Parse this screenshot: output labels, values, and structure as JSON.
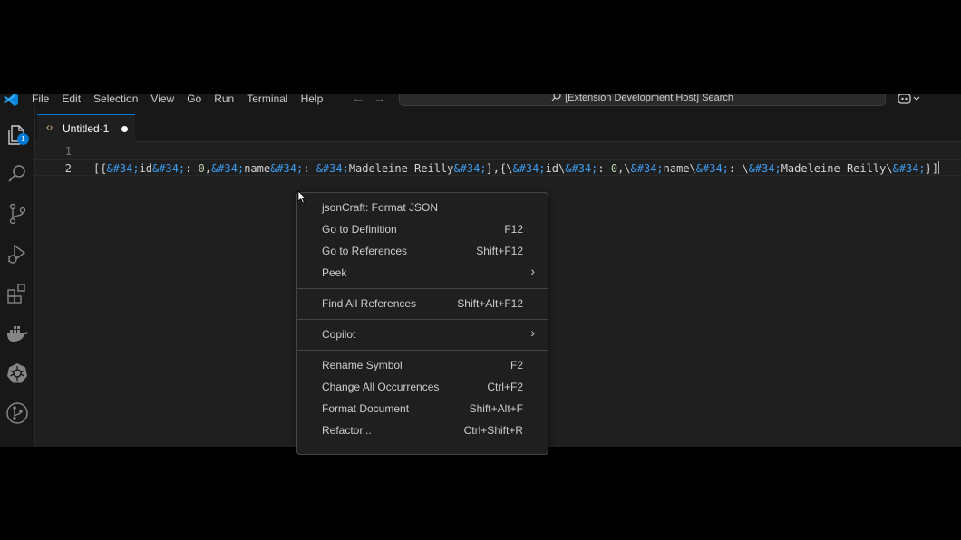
{
  "menubar": {
    "items": [
      "File",
      "Edit",
      "Selection",
      "View",
      "Go",
      "Run",
      "Terminal",
      "Help"
    ],
    "search_text": "[Extension Development Host] Search"
  },
  "icons": {
    "logo": "vscode-logo-icon",
    "back": "arrow-left-icon",
    "forward": "arrow-right-icon",
    "search": "search-icon",
    "copilot": "copilot-icon",
    "activity": [
      "explorer-icon",
      "search-icon",
      "source-control-icon",
      "run-debug-icon",
      "extensions-icon",
      "docker-icon",
      "kubernetes-icon",
      "git-graph-icon"
    ]
  },
  "activitybar": {
    "explorer_badge": "1"
  },
  "tab": {
    "label": "Untitled-1",
    "modified": true
  },
  "editor": {
    "line_numbers": [
      "1",
      "2"
    ],
    "line2": "[{&#34;id&#34;: 0,&#34;name&#34;: &#34;Madeleine Reilly&#34;},{\\&#34;id\\&#34;: 0,\\&#34;name\\&#34;: \\&#34;Madeleine Reilly\\&#34;}]"
  },
  "context_menu": {
    "items": [
      {
        "label": "jsonCraft: Format JSON",
        "shortcut": ""
      },
      {
        "label": "Go to Definition",
        "shortcut": "F12"
      },
      {
        "label": "Go to References",
        "shortcut": "Shift+F12"
      },
      {
        "label": "Peek",
        "shortcut": "",
        "submenu": true
      },
      {
        "label": "Find All References",
        "shortcut": "Shift+Alt+F12"
      },
      {
        "label": "Copilot",
        "shortcut": "",
        "submenu": true
      },
      {
        "label": "Rename Symbol",
        "shortcut": "F2"
      },
      {
        "label": "Change All Occurrences",
        "shortcut": "Ctrl+F2"
      },
      {
        "label": "Format Document",
        "shortcut": "Shift+Alt+F"
      },
      {
        "label": "Refactor...",
        "shortcut": "Ctrl+Shift+R"
      }
    ]
  },
  "colors": {
    "accent": "#0078d4",
    "editor_bg": "#1f1f1f",
    "entity": "#3c9cf0",
    "number": "#b5cea8"
  }
}
